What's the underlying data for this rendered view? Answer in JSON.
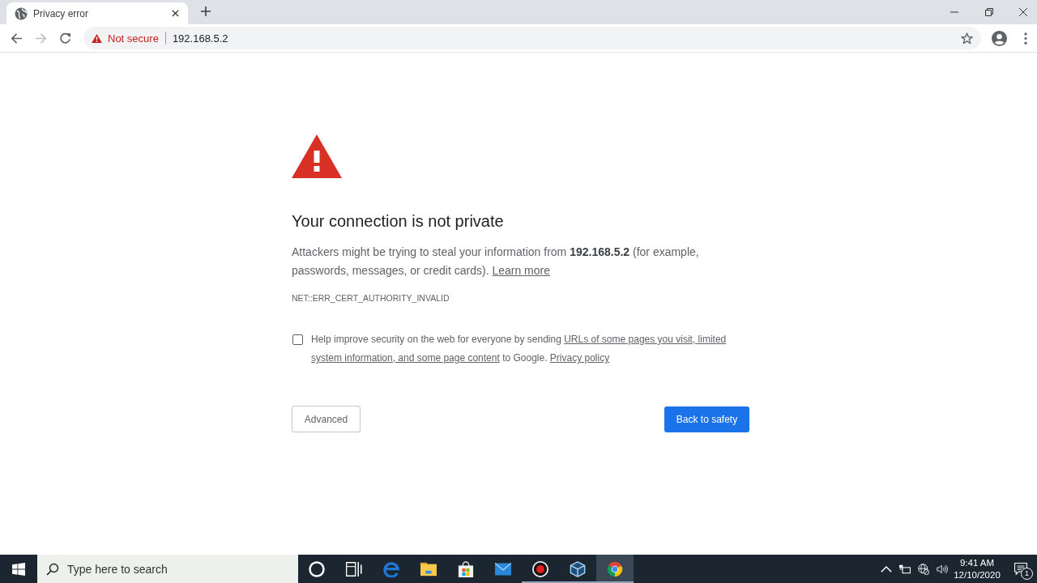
{
  "window": {
    "tabs": [
      {
        "title": "Privacy error",
        "selected": true
      }
    ]
  },
  "toolbar": {
    "back": {
      "disabled": false
    },
    "forward": {
      "disabled": true
    },
    "security_label": "Not secure",
    "url": "192.168.5.2"
  },
  "page": {
    "heading": "Your connection is not private",
    "message": "Attackers might be trying to steal your information from **192.168.5.2** (for example, passwords, messages, or credit cards).",
    "learn_more": "Learn more",
    "error_code": "NET::ERR_CERT_AUTHORITY_INVALID",
    "opt_in": {
      "checked": false,
      "text_before": "Help improve security on the web for everyone by sending",
      "link_lines": [
        "URLs of some pages you visit, limited",
        "system information, and some page content"
      ],
      "text_after": "to Google.",
      "privacy_link": "Privacy policy"
    },
    "advanced_button": "Advanced",
    "back_button": "Back to safety"
  },
  "taskbar": {
    "search": {
      "placeholder": "Type here to search"
    },
    "apps": [
      {
        "kind": "cortana",
        "running": false,
        "selected": false
      },
      {
        "kind": "task-view",
        "running": false,
        "selected": false
      },
      {
        "kind": "edge",
        "running": false,
        "selected": false
      },
      {
        "kind": "file-explorer",
        "running": false,
        "selected": false
      },
      {
        "kind": "store",
        "running": false,
        "selected": false
      },
      {
        "kind": "mail",
        "running": false,
        "selected": false
      },
      {
        "kind": "recorder",
        "running": true,
        "selected": false
      },
      {
        "kind": "virtualbox",
        "running": true,
        "selected": false
      },
      {
        "kind": "chrome",
        "running": true,
        "selected": true
      }
    ],
    "time": "9:41 AM",
    "date": "12/10/2020",
    "notification_count": "1"
  }
}
